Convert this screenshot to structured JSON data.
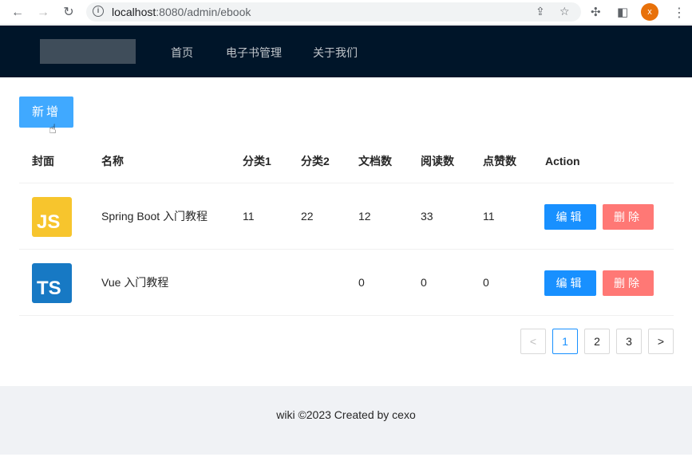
{
  "browser": {
    "url_host": "localhost",
    "url_rest": ":8080/admin/ebook",
    "profile_initial": "x"
  },
  "header": {
    "menu": [
      "首页",
      "电子书管理",
      "关于我们"
    ]
  },
  "toolbar": {
    "add_label": "新增"
  },
  "table": {
    "columns": [
      "封面",
      "名称",
      "分类1",
      "分类2",
      "文档数",
      "阅读数",
      "点赞数",
      "Action"
    ],
    "rows": [
      {
        "cover_text": "JS",
        "name": "Spring Boot 入门教程",
        "category1": "11",
        "category2": "22",
        "doc_count": "12",
        "view_count": "33",
        "vote_count": "11",
        "edit_label": "编辑",
        "delete_label": "删除"
      },
      {
        "cover_text": "TS",
        "name": "Vue 入门教程",
        "category1": "",
        "category2": "",
        "doc_count": "0",
        "view_count": "0",
        "vote_count": "0",
        "edit_label": "编辑",
        "delete_label": "删除"
      }
    ]
  },
  "pagination": {
    "prev": "<",
    "pages": [
      "1",
      "2",
      "3"
    ],
    "next": ">",
    "current": "1"
  },
  "footer": {
    "text": "wiki ©2023 Created by cexo"
  },
  "colors": {
    "header_bg": "#001529",
    "primary": "#1890ff",
    "danger": "#ff7875",
    "add_button": "#40a9ff"
  }
}
